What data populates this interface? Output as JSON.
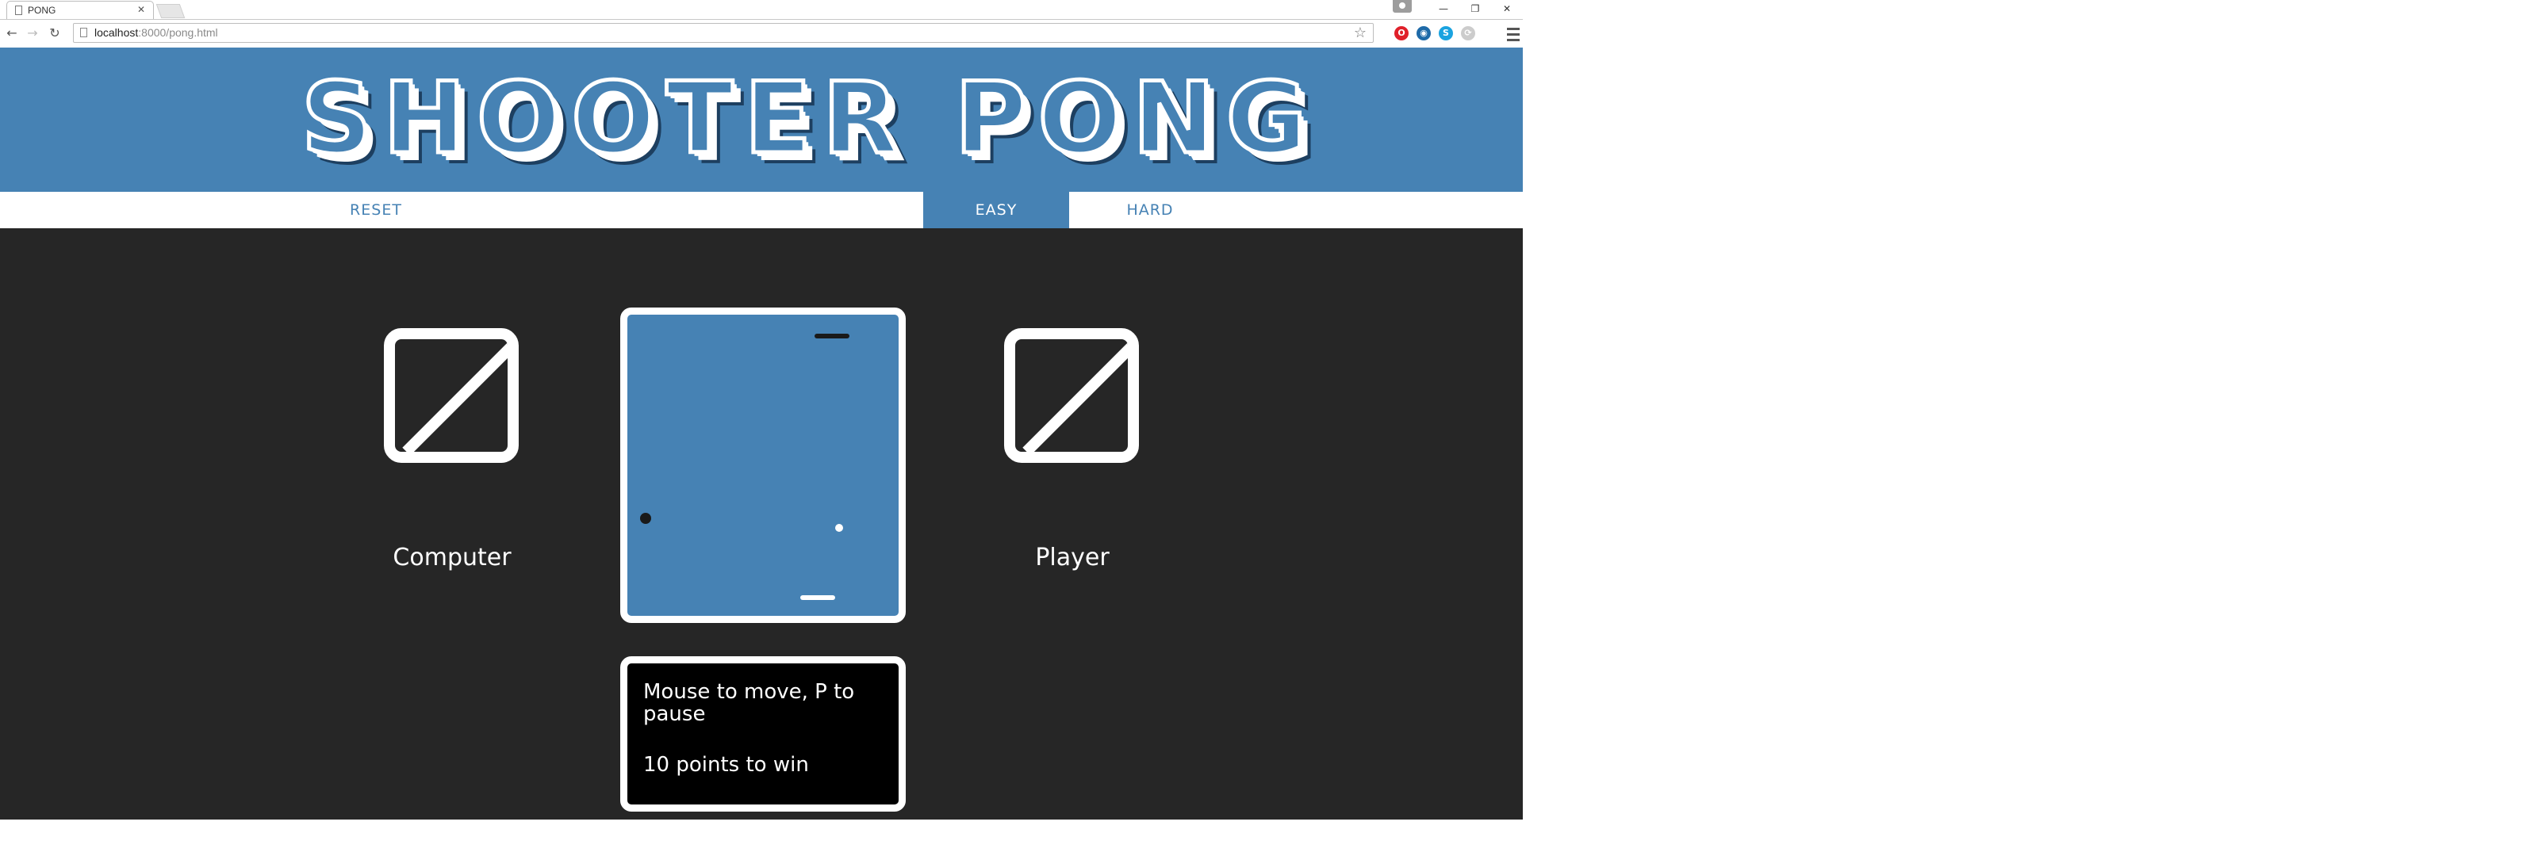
{
  "browser": {
    "tab_title": "PONG",
    "tab_close": "✕",
    "url_host": "localhost",
    "url_rest": ":8000/pong.html",
    "window_controls": [
      "—",
      "❐",
      "✕"
    ],
    "extensions": [
      {
        "name": "opera-icon",
        "color": "#e0202a",
        "glyph": "O"
      },
      {
        "name": "globe-icon",
        "color": "#1e6aa8",
        "glyph": "◉"
      },
      {
        "name": "skype-icon",
        "color": "#1aa3e0",
        "glyph": "S"
      },
      {
        "name": "sync-icon",
        "color": "#bbbbbb",
        "glyph": "⟳"
      }
    ]
  },
  "header": {
    "logo_text": "SHOOTER PONG"
  },
  "nav": {
    "reset": "RESET",
    "easy": "EASY",
    "hard": "HARD",
    "active": "EASY"
  },
  "game": {
    "left_label": "Computer",
    "right_label": "Player",
    "left_score_glyph": "Ø",
    "right_score_glyph": "Ø",
    "board_color": "#4682b4",
    "top_paddle_color": "#1a1a1a",
    "bottom_paddle_color": "#ffffff",
    "ball_dark_color": "#1a1a1a",
    "ball_light_color": "#ffffff"
  },
  "info": {
    "line1": "Mouse to move, P to pause",
    "line2": "10 points to win"
  },
  "colors": {
    "accent": "#4682b4",
    "background": "#262626"
  }
}
